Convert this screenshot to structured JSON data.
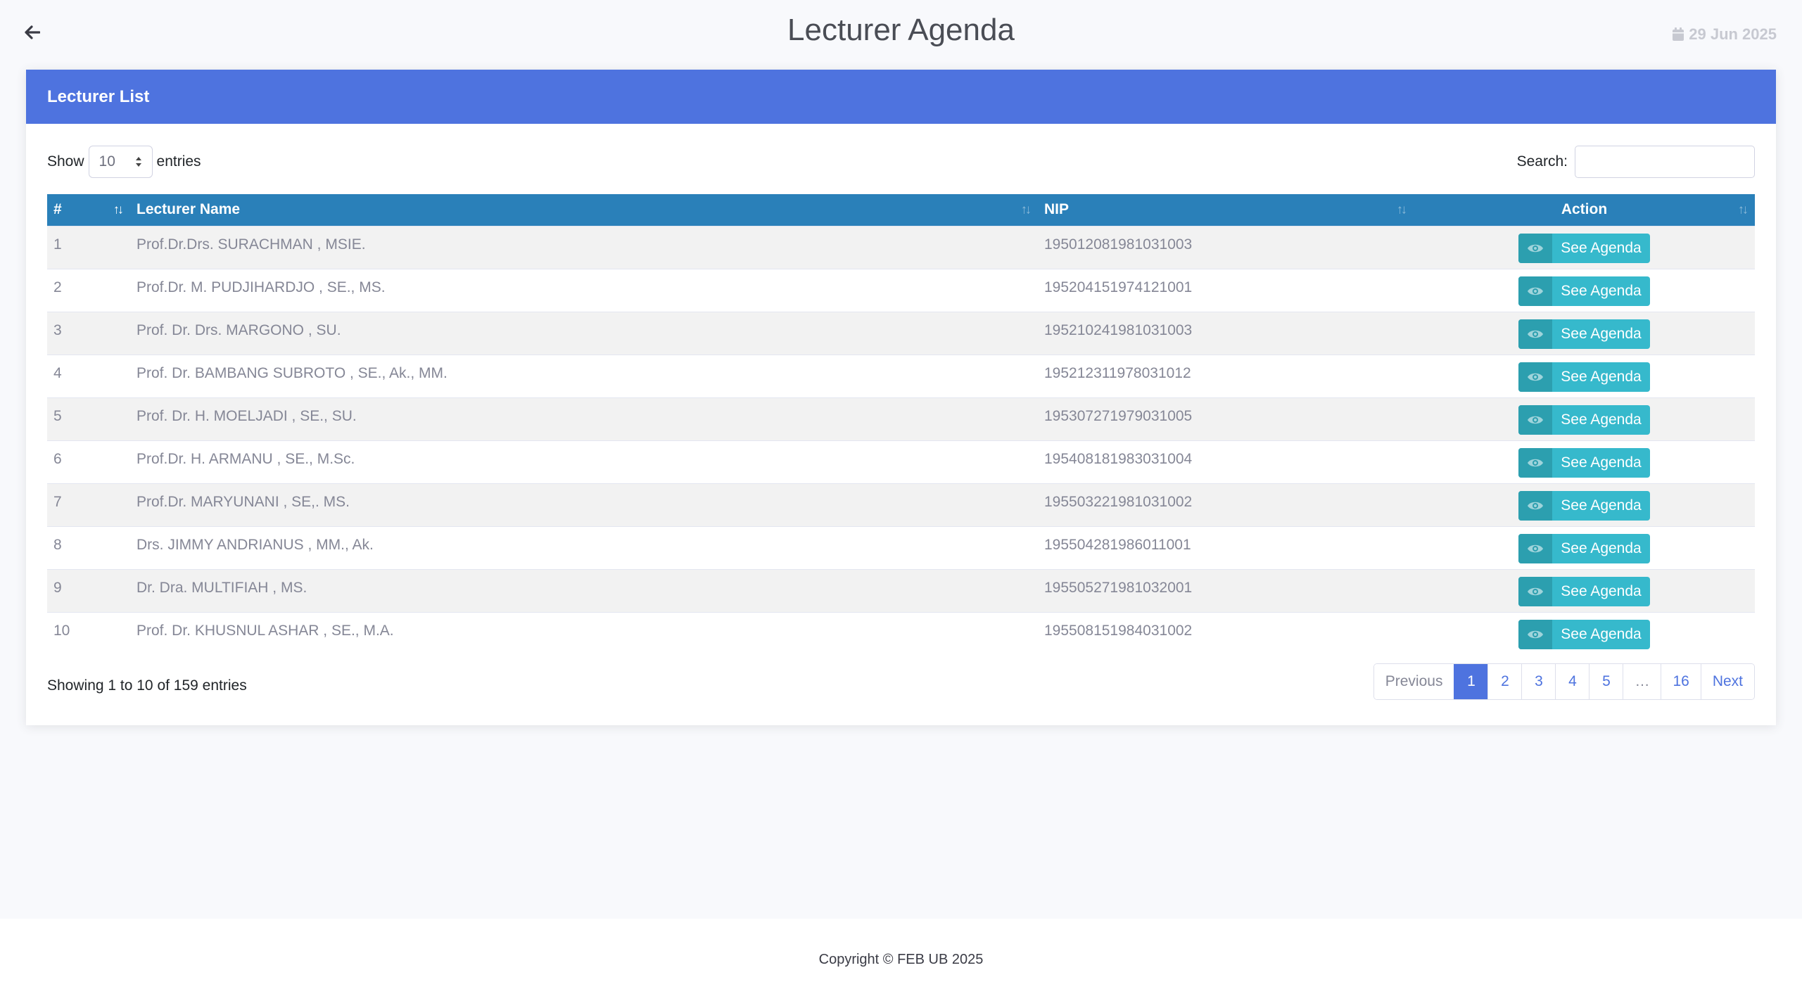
{
  "header": {
    "title": "Lecturer Agenda",
    "date": "29 Jun 2025",
    "back_icon": "arrow-left-icon",
    "date_icon": "calendar-icon"
  },
  "card": {
    "title": "Lecturer List",
    "header_color": "#4e73df"
  },
  "controls": {
    "show_label": "Show",
    "page_length": "10",
    "entries_label": "entries",
    "search_label": "Search:",
    "search_value": ""
  },
  "table": {
    "columns": [
      "#",
      "Lecturer Name",
      "NIP",
      "Action"
    ],
    "header_color": "#2a80b9",
    "action_label": "See Agenda",
    "action_icon": "eye-icon",
    "action_color": "#36b9cc",
    "rows": [
      {
        "no": "1",
        "name": "Prof.Dr.Drs. SURACHMAN , MSIE.",
        "nip": "195012081981031003"
      },
      {
        "no": "2",
        "name": "Prof.Dr. M. PUDJIHARDJO , SE., MS.",
        "nip": "195204151974121001"
      },
      {
        "no": "3",
        "name": "Prof. Dr. Drs. MARGONO , SU.",
        "nip": "195210241981031003"
      },
      {
        "no": "4",
        "name": "Prof. Dr. BAMBANG SUBROTO , SE., Ak., MM.",
        "nip": "195212311978031012"
      },
      {
        "no": "5",
        "name": "Prof. Dr. H. MOELJADI , SE., SU.",
        "nip": "195307271979031005"
      },
      {
        "no": "6",
        "name": "Prof.Dr. H. ARMANU , SE., M.Sc.",
        "nip": "195408181983031004"
      },
      {
        "no": "7",
        "name": "Prof.Dr. MARYUNANI , SE,. MS.",
        "nip": "195503221981031002"
      },
      {
        "no": "8",
        "name": "Drs. JIMMY ANDRIANUS , MM., Ak.",
        "nip": "195504281986011001"
      },
      {
        "no": "9",
        "name": "Dr. Dra. MULTIFIAH , MS.",
        "nip": "195505271981032001"
      },
      {
        "no": "10",
        "name": "Prof. Dr. KHUSNUL ASHAR , SE., M.A.",
        "nip": "195508151984031002"
      }
    ]
  },
  "info": {
    "text": "Showing 1 to 10 of 159 entries"
  },
  "pagination": {
    "previous": "Previous",
    "pages": [
      "1",
      "2",
      "3",
      "4",
      "5",
      "…",
      "16"
    ],
    "active": "1",
    "next": "Next"
  },
  "footer": {
    "text": "Copyright © FEB UB 2025"
  }
}
